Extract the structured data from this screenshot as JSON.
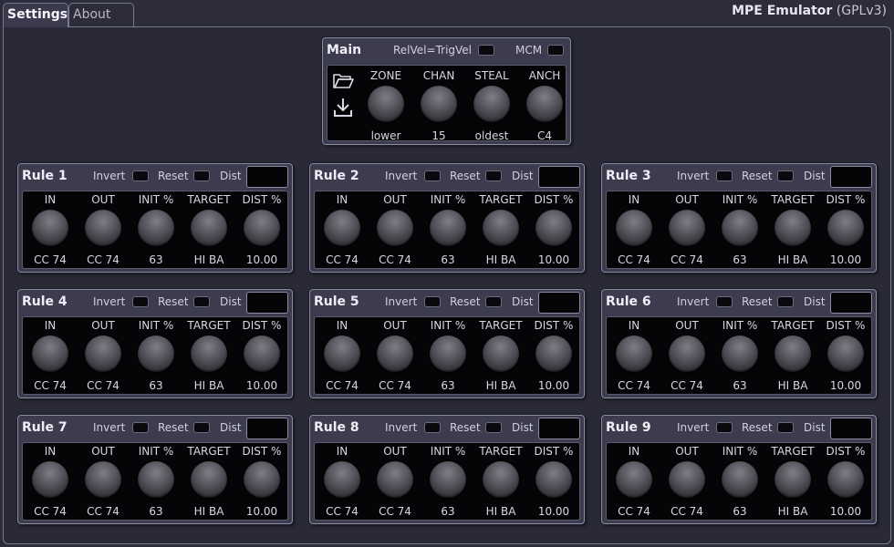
{
  "tabs": [
    {
      "label": "Settings",
      "active": true
    },
    {
      "label": "About",
      "active": false
    }
  ],
  "app": {
    "name": "MPE Emulator",
    "license": "(GPLv3)"
  },
  "main": {
    "title": "Main",
    "relvel_label": "RelVel=TrigVel",
    "mcm_label": "MCM",
    "icons": [
      "folder-open-icon",
      "download-icon"
    ],
    "knobs": [
      {
        "label": "ZONE",
        "value": "lower"
      },
      {
        "label": "CHAN",
        "value": "15"
      },
      {
        "label": "STEAL",
        "value": "oldest"
      },
      {
        "label": "ANCH",
        "value": "C4"
      }
    ]
  },
  "rule_option_labels": {
    "invert": "Invert",
    "reset": "Reset",
    "dist": "Dist"
  },
  "rules": [
    {
      "title": "Rule 1",
      "knobs": [
        {
          "label": "IN",
          "value": "CC 74"
        },
        {
          "label": "OUT",
          "value": "CC 74"
        },
        {
          "label": "INIT %",
          "value": "63"
        },
        {
          "label": "TARGET",
          "value": "HI BA"
        },
        {
          "label": "DIST %",
          "value": "10.00"
        }
      ]
    },
    {
      "title": "Rule 2",
      "knobs": [
        {
          "label": "IN",
          "value": "CC 74"
        },
        {
          "label": "OUT",
          "value": "CC 74"
        },
        {
          "label": "INIT %",
          "value": "63"
        },
        {
          "label": "TARGET",
          "value": "HI BA"
        },
        {
          "label": "DIST %",
          "value": "10.00"
        }
      ]
    },
    {
      "title": "Rule 3",
      "knobs": [
        {
          "label": "IN",
          "value": "CC 74"
        },
        {
          "label": "OUT",
          "value": "CC 74"
        },
        {
          "label": "INIT %",
          "value": "63"
        },
        {
          "label": "TARGET",
          "value": "HI BA"
        },
        {
          "label": "DIST %",
          "value": "10.00"
        }
      ]
    },
    {
      "title": "Rule 4",
      "knobs": [
        {
          "label": "IN",
          "value": "CC 74"
        },
        {
          "label": "OUT",
          "value": "CC 74"
        },
        {
          "label": "INIT %",
          "value": "63"
        },
        {
          "label": "TARGET",
          "value": "HI BA"
        },
        {
          "label": "DIST %",
          "value": "10.00"
        }
      ]
    },
    {
      "title": "Rule 5",
      "knobs": [
        {
          "label": "IN",
          "value": "CC 74"
        },
        {
          "label": "OUT",
          "value": "CC 74"
        },
        {
          "label": "INIT %",
          "value": "63"
        },
        {
          "label": "TARGET",
          "value": "HI BA"
        },
        {
          "label": "DIST %",
          "value": "10.00"
        }
      ]
    },
    {
      "title": "Rule 6",
      "knobs": [
        {
          "label": "IN",
          "value": "CC 74"
        },
        {
          "label": "OUT",
          "value": "CC 74"
        },
        {
          "label": "INIT %",
          "value": "63"
        },
        {
          "label": "TARGET",
          "value": "HI BA"
        },
        {
          "label": "DIST %",
          "value": "10.00"
        }
      ]
    },
    {
      "title": "Rule 7",
      "knobs": [
        {
          "label": "IN",
          "value": "CC 74"
        },
        {
          "label": "OUT",
          "value": "CC 74"
        },
        {
          "label": "INIT %",
          "value": "63"
        },
        {
          "label": "TARGET",
          "value": "HI BA"
        },
        {
          "label": "DIST %",
          "value": "10.00"
        }
      ]
    },
    {
      "title": "Rule 8",
      "knobs": [
        {
          "label": "IN",
          "value": "CC 74"
        },
        {
          "label": "OUT",
          "value": "CC 74"
        },
        {
          "label": "INIT %",
          "value": "63"
        },
        {
          "label": "TARGET",
          "value": "HI BA"
        },
        {
          "label": "DIST %",
          "value": "10.00"
        }
      ]
    },
    {
      "title": "Rule 9",
      "knobs": [
        {
          "label": "IN",
          "value": "CC 74"
        },
        {
          "label": "OUT",
          "value": "CC 74"
        },
        {
          "label": "INIT %",
          "value": "63"
        },
        {
          "label": "TARGET",
          "value": "HI BA"
        },
        {
          "label": "DIST %",
          "value": "10.00"
        }
      ]
    }
  ]
}
